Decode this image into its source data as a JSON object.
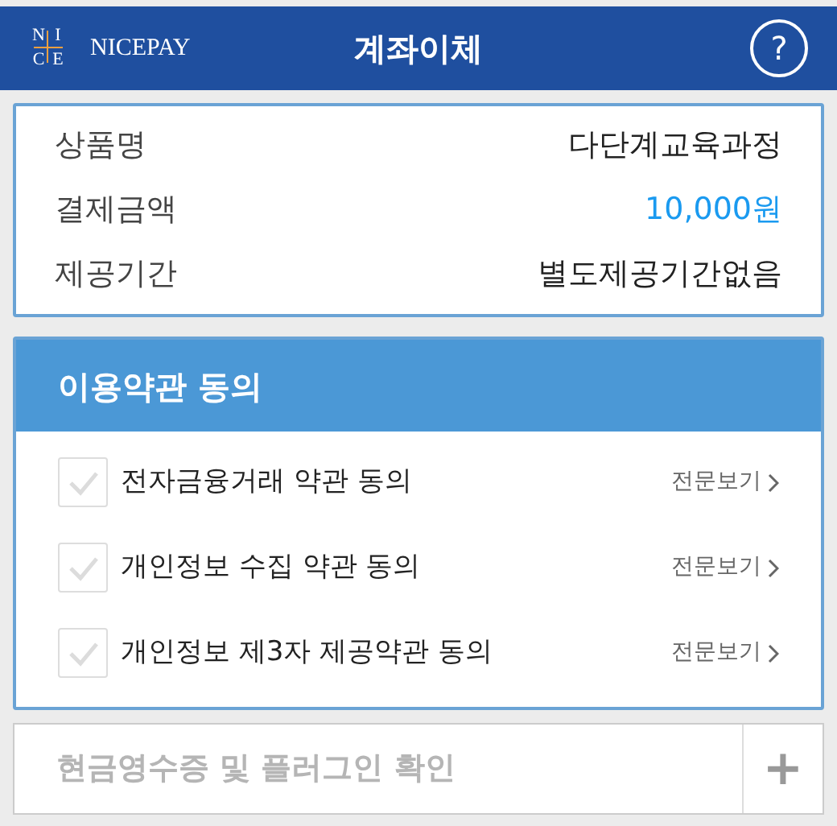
{
  "header": {
    "logo_letters": [
      "N",
      "I",
      "C",
      "E"
    ],
    "brand": "NICEPAY",
    "title": "계좌이체",
    "help": "?"
  },
  "summary": [
    {
      "label": "상품명",
      "value": "다단계교육과정",
      "kind": "plain"
    },
    {
      "label": "결제금액",
      "value": "10,000원",
      "kind": "amount"
    },
    {
      "label": "제공기간",
      "value": "별도제공기간없음",
      "kind": "plain"
    }
  ],
  "terms": {
    "title": "이용약관 동의",
    "items": [
      {
        "label": "전자금융거래 약관 동의",
        "checked": false,
        "link": "전문보기"
      },
      {
        "label": "개인정보 수집 약관 동의",
        "checked": false,
        "link": "전문보기"
      },
      {
        "label": "개인정보 제3자 제공약관 동의",
        "checked": false,
        "link": "전문보기"
      }
    ]
  },
  "receipt": {
    "label": "현금영수증 및 플러그인 확인",
    "expand": "+"
  }
}
